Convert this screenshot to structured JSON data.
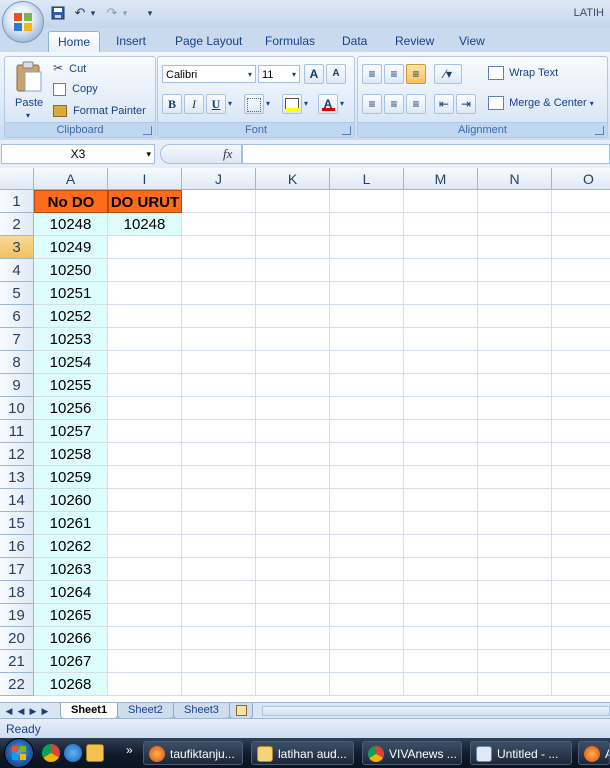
{
  "window": {
    "title": "LATIH"
  },
  "tabs": [
    "Home",
    "Insert",
    "Page Layout",
    "Formulas",
    "Data",
    "Review",
    "View"
  ],
  "ribbon": {
    "clipboard": {
      "label": "Clipboard",
      "paste": "Paste",
      "cut": "Cut",
      "copy": "Copy",
      "format_painter": "Format Painter"
    },
    "font": {
      "label": "Font",
      "family": "Calibri",
      "size": "11",
      "bold": "B",
      "italic": "I",
      "underline": "U",
      "grow": "A",
      "shrink": "A"
    },
    "alignment": {
      "label": "Alignment",
      "wrap_text": "Wrap Text",
      "merge_center": "Merge & Center"
    }
  },
  "formula_bar": {
    "name_box": "X3",
    "fx": "fx",
    "value": ""
  },
  "columns": [
    "A",
    "I",
    "J",
    "K",
    "L",
    "M",
    "N",
    "O"
  ],
  "rows": [
    "1",
    "2",
    "3",
    "4",
    "5",
    "6",
    "7",
    "8",
    "9",
    "10",
    "11",
    "12",
    "13",
    "14",
    "15",
    "16",
    "17",
    "18",
    "19",
    "20",
    "21",
    "22"
  ],
  "cells": {
    "A1": "No DO",
    "I1": "DO URUT",
    "A": [
      "10248",
      "10249",
      "10250",
      "10251",
      "10252",
      "10253",
      "10254",
      "10255",
      "10256",
      "10257",
      "10258",
      "10259",
      "10260",
      "10261",
      "10262",
      "10263",
      "10264",
      "10265",
      "10266",
      "10267",
      "10268"
    ],
    "I2": "10248"
  },
  "sheets": [
    "Sheet1",
    "Sheet2",
    "Sheet3"
  ],
  "status": "Ready",
  "taskbar": {
    "tasks": [
      "taufiktanju...",
      "latihan aud...",
      "VIVAnews ...",
      "Untitled - ...",
      "A"
    ]
  },
  "colors": {
    "header_orange": "#fe6b1b",
    "cyan_fill": "#ddfcfc",
    "selected_header": "#f1c15f"
  }
}
